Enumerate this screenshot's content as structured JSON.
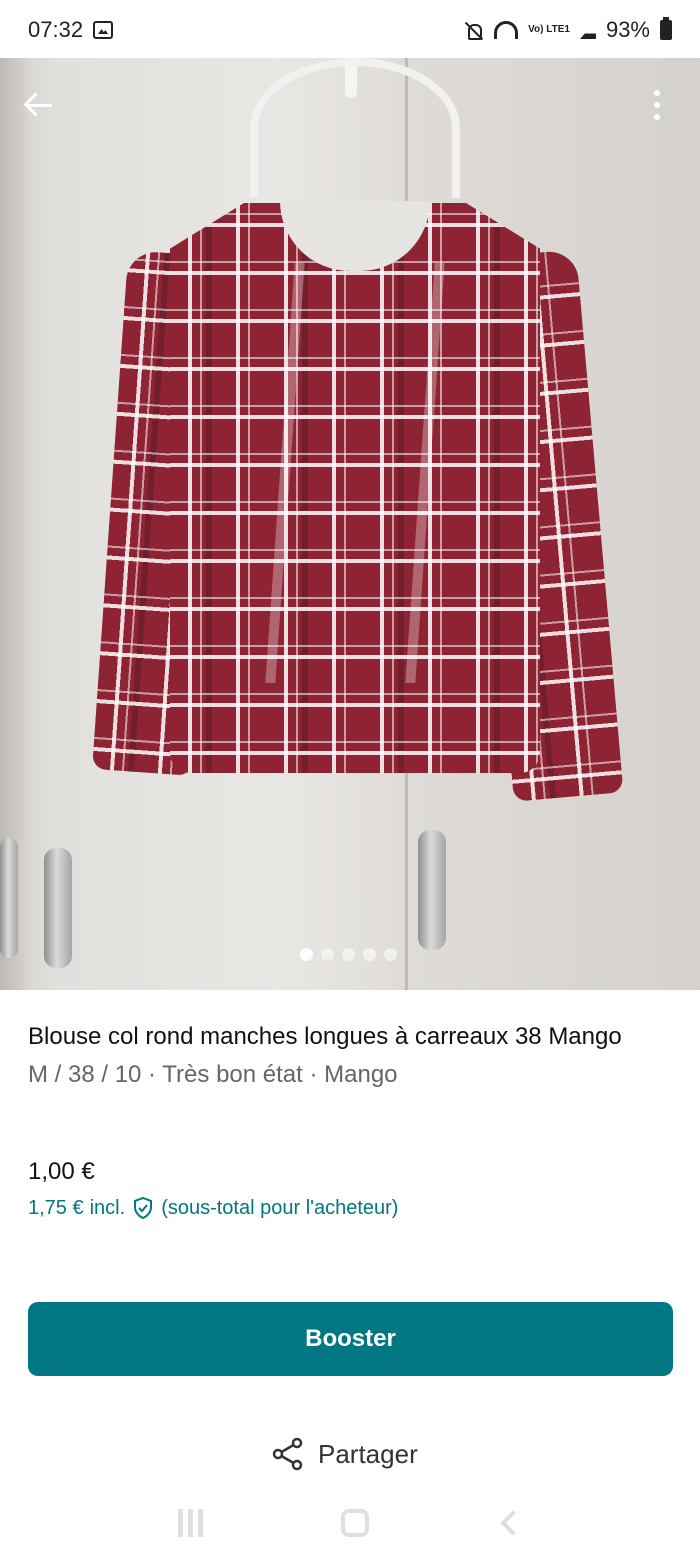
{
  "status_bar": {
    "time": "07:32",
    "battery": "93%",
    "network_label": "Vo) LTE1"
  },
  "photo": {
    "image_count": 5,
    "active_index": 0
  },
  "item": {
    "title": "Blouse col rond manches longues à carreaux 38 Mango",
    "subtitle": "M / 38 / 10 · Très bon état · Mango",
    "price": "1,00 €",
    "price_incl": "1,75 €",
    "incl_label": "incl.",
    "incl_note": "(sous-total pour l'acheteur)"
  },
  "actions": {
    "booster_label": "Booster",
    "share_label": "Partager"
  },
  "colors": {
    "accent": "#007782",
    "blouse": "#8e2333"
  },
  "icons": [
    "back-arrow-icon",
    "more-icon",
    "shield-check-icon",
    "share-icon"
  ]
}
